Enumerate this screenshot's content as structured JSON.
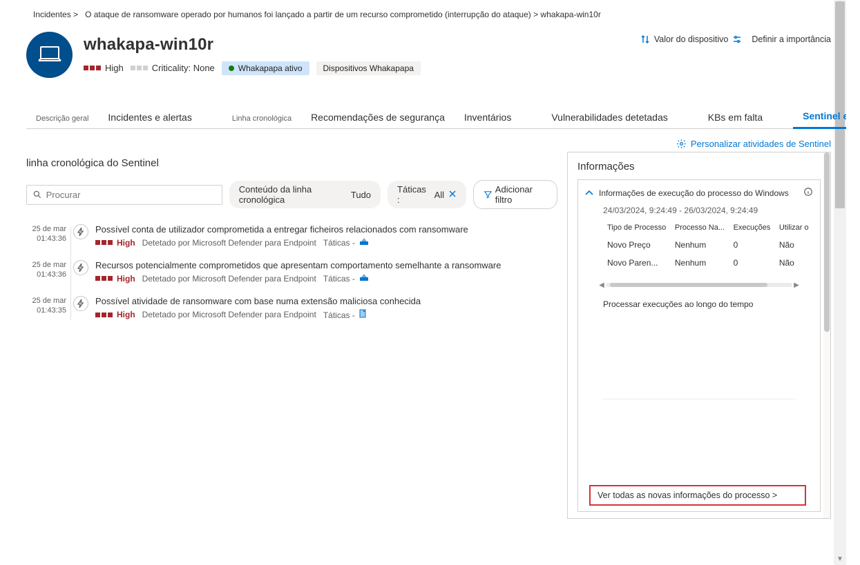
{
  "breadcrumb": {
    "part1": "Incidentes >",
    "part2": "O ataque de ransomware operado por humanos foi lançado a partir de um recurso comprometido (interrupção do ataque) > whakapa-win10r"
  },
  "device": {
    "title": "whakapa-win10r",
    "severity_label": "High",
    "criticality_label": "Criticality: None",
    "tag_active": "Whakapapa ativo",
    "tag_group": "Dispositivos Whakapapa"
  },
  "header_actions": {
    "value": "Valor do dispositivo",
    "importance": "Definir a importância"
  },
  "tabs": {
    "overview": "Descrição geral",
    "incidents": "Incidentes e alertas",
    "timeline_small": "Linha cronológica",
    "recommend": "Recomendações de segurança",
    "inventories": "Inventários",
    "vulns": "Vulnerabilidades detetadas",
    "kbs": "KBs em falta",
    "sentinel": "Sentinel eventos",
    "overflow": "..."
  },
  "toolbar": {
    "customize": "Personalizar atividades de Sentinel"
  },
  "section": {
    "title": "linha cronológica do Sentinel"
  },
  "search": {
    "placeholder": "Procurar"
  },
  "chips": {
    "content_label": "Conteúdo da linha cronológica",
    "content_value": "Tudo",
    "tactics_label": "Táticas :",
    "tactics_value": "All",
    "add_filter": "Adicionar filtro"
  },
  "events": [
    {
      "date": "25 de mar",
      "time": "01:43:36",
      "title": "Possível conta de utilizador comprometida a entregar ficheiros relacionados com ransomware",
      "severity": "High",
      "detected_by": "Detetado por Microsoft Defender para Endpoint",
      "tactics_label": "Táticas -"
    },
    {
      "date": "25 de mar",
      "time": "01:43:36",
      "title": "Recursos potencialmente comprometidos que apresentam comportamento semelhante a ransomware",
      "severity": "High",
      "detected_by": "Detetado por Microsoft Defender para Endpoint",
      "tactics_label": "Táticas -"
    },
    {
      "date": "25 de mar",
      "time": "01:43:35",
      "title": "Possível atividade de ransomware com base numa extensão maliciosa conhecida",
      "severity": "High",
      "detected_by": "Detetado por Microsoft Defender para Endpoint",
      "tactics_label": "Táticas -"
    }
  ],
  "panel": {
    "title": "Informações",
    "accordion_title": "Informações de execução do processo do Windows",
    "date_range": "24/03/2024, 9:24:49 - 26/03/2024, 9:24:49",
    "columns": {
      "c1": "Tipo de Processo",
      "c2": "Processo Na...",
      "c3": "Execuções",
      "c4": "Utilizar o"
    },
    "rows": [
      {
        "c1": "Novo Preço",
        "c2": "Nenhum",
        "c3": "0",
        "c4": "Não"
      },
      {
        "c1": "Novo Paren...",
        "c2": "Nenhum",
        "c3": "0",
        "c4": "Não"
      }
    ],
    "exec_caption": "Processar execuções ao longo do tempo",
    "view_all": "Ver todas as novas informações do processo >"
  }
}
